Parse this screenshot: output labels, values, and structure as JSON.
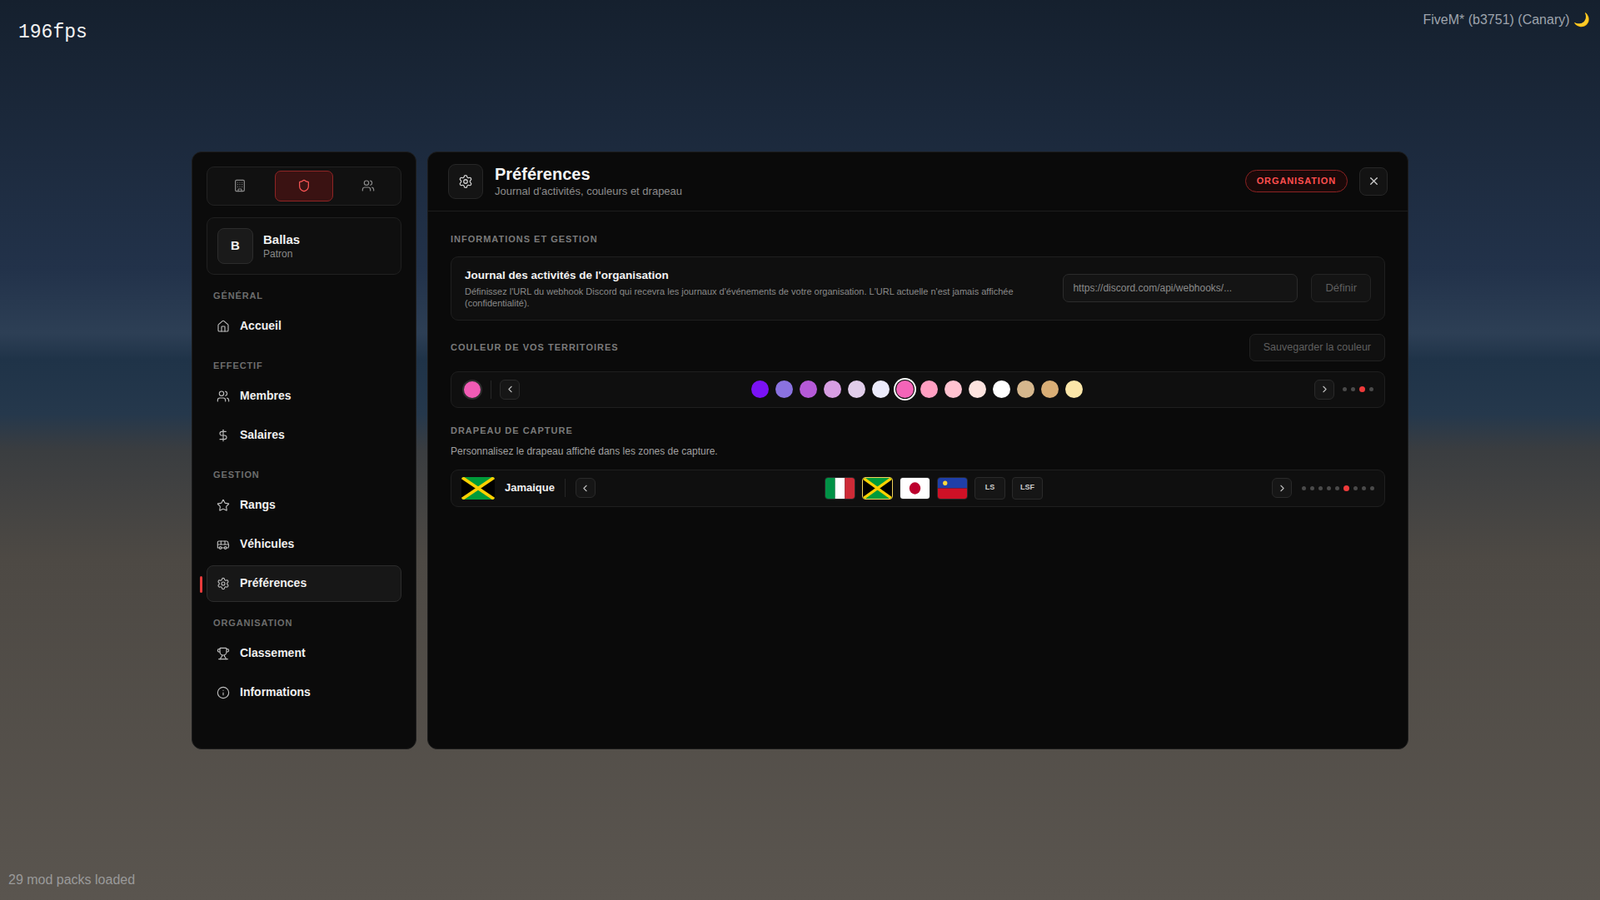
{
  "overlay": {
    "fps": "196fps",
    "build": "FiveM* (b3751) (Canary) 🌙",
    "mods": "29 mod packs loaded"
  },
  "sidebar": {
    "tabs": [
      {
        "selected": false
      },
      {
        "selected": true
      },
      {
        "selected": false
      }
    ],
    "org": {
      "initial": "B",
      "name": "Ballas",
      "role": "Patron"
    },
    "sections": [
      {
        "title": "GÉNÉRAL",
        "items": [
          {
            "label": "Accueil",
            "selected": false
          }
        ]
      },
      {
        "title": "EFFECTIF",
        "items": [
          {
            "label": "Membres",
            "selected": false
          },
          {
            "label": "Salaires",
            "selected": false
          }
        ]
      },
      {
        "title": "GESTION",
        "items": [
          {
            "label": "Rangs",
            "selected": false
          },
          {
            "label": "Véhicules",
            "selected": false
          },
          {
            "label": "Préférences",
            "selected": true
          }
        ]
      },
      {
        "title": "ORGANISATION",
        "items": [
          {
            "label": "Classement",
            "selected": false
          },
          {
            "label": "Informations",
            "selected": false
          }
        ]
      }
    ]
  },
  "header": {
    "title": "Préférences",
    "subtitle": "Journal d'activités, couleurs et drapeau",
    "badge": "ORGANISATION"
  },
  "info": {
    "title": "INFORMATIONS ET GESTION",
    "card": {
      "title": "Journal des activités de l'organisation",
      "description": "Définissez l'URL du webhook Discord qui recevra les journaux d'événements de votre organisation. L'URL actuelle n'est jamais affichée (confidentialité).",
      "placeholder": "https://discord.com/api/webhooks/...",
      "button": {
        "label": "Définir",
        "disabled": true
      }
    }
  },
  "colors": {
    "title": "COULEUR DE VOS TERRITOIRES",
    "save": {
      "label": "Sauvegarder la couleur",
      "disabled": true
    },
    "current": "#f15bb5",
    "swatches": [
      {
        "color": "#7a12f5",
        "selected": false
      },
      {
        "color": "#8a72e0",
        "selected": false
      },
      {
        "color": "#b65ad8",
        "selected": false
      },
      {
        "color": "#d79ee2",
        "selected": false
      },
      {
        "color": "#e1cdea",
        "selected": false
      },
      {
        "color": "#ecebfb",
        "selected": false
      },
      {
        "color": "#f464b8",
        "selected": true
      },
      {
        "color": "#ff9fc2",
        "selected": false
      },
      {
        "color": "#ffc2d0",
        "selected": false
      },
      {
        "color": "#fde3df",
        "selected": false
      },
      {
        "color": "#ffffff",
        "selected": false
      },
      {
        "color": "#d6b78d",
        "selected": false
      },
      {
        "color": "#d9ae76",
        "selected": false
      },
      {
        "color": "#fbe6a9",
        "selected": false
      }
    ],
    "pages": [
      {
        "selected": false
      },
      {
        "selected": false
      },
      {
        "selected": true
      },
      {
        "selected": false
      }
    ]
  },
  "flags": {
    "title": "DRAPEAU DE CAPTURE",
    "description": "Personnalisez le drapeau affiché dans les zones de capture.",
    "current": {
      "kind": "jamaica",
      "label": "Jamaique"
    },
    "items": [
      {
        "kind": "italy",
        "text": "",
        "selected": false
      },
      {
        "kind": "jamaica",
        "text": "",
        "selected": true
      },
      {
        "kind": "japan",
        "text": "",
        "selected": false
      },
      {
        "kind": "liechtenstein",
        "text": "",
        "selected": false
      },
      {
        "kind": "text",
        "text": "LS",
        "selected": false
      },
      {
        "kind": "text",
        "text": "LSF",
        "selected": false
      }
    ],
    "pages": [
      {
        "selected": false
      },
      {
        "selected": false
      },
      {
        "selected": false
      },
      {
        "selected": false
      },
      {
        "selected": false
      },
      {
        "selected": true
      },
      {
        "selected": false
      },
      {
        "selected": false
      },
      {
        "selected": false
      }
    ]
  }
}
